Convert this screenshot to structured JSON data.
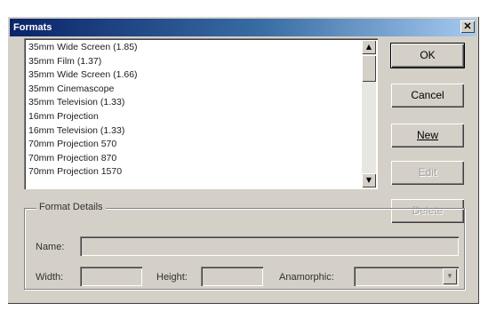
{
  "window": {
    "title": "Formats",
    "close_glyph": "✕"
  },
  "format_list": {
    "items": [
      "35mm Wide Screen (1.85)",
      "35mm Film (1.37)",
      "35mm Wide Screen (1.66)",
      "35mm Cinemascope",
      "35mm Television (1.33)",
      "16mm Projection",
      "16mm Television (1.33)",
      "70mm Projection 570",
      "70mm Projection 870",
      "70mm Projection 1570"
    ],
    "scroll_up_glyph": "▲",
    "scroll_down_glyph": "▼"
  },
  "buttons": {
    "ok": "OK",
    "cancel": "Cancel",
    "new": "New",
    "edit": "Edit",
    "delete": "Delete"
  },
  "details": {
    "group_title": "Format Details",
    "name_label": "Name:",
    "width_label": "Width:",
    "height_label": "Height:",
    "anamorphic_label": "Anamorphic:",
    "name_value": "",
    "width_value": "",
    "height_value": "",
    "anamorphic_value": "",
    "combo_arrow_glyph": "▼"
  }
}
